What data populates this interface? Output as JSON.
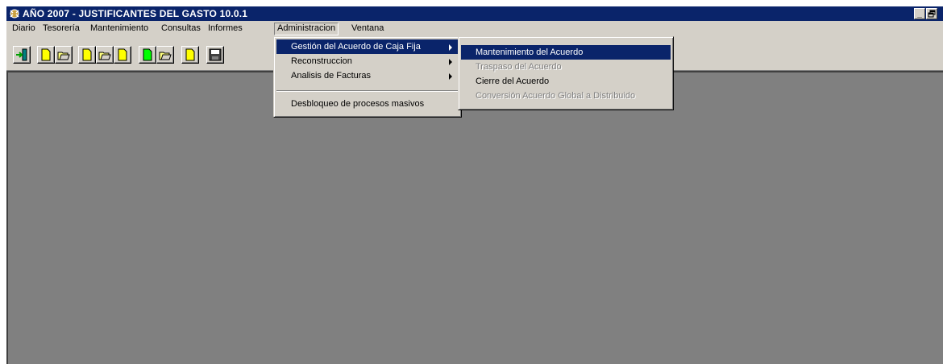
{
  "window": {
    "title": "AÑO 2007 - JUSTIFICANTES DEL GASTO 10.0.1",
    "minimize_label": "_",
    "restore_label": "▫"
  },
  "menubar": {
    "items": [
      {
        "label": "Diario"
      },
      {
        "label": "Tesorería"
      },
      {
        "label": "Mantenimiento"
      },
      {
        "label": "Consultas"
      },
      {
        "label": "Informes"
      },
      {
        "label": "Administracion"
      },
      {
        "label": "Ventana"
      }
    ],
    "active": "Administracion"
  },
  "toolbar": {
    "buttons": [
      {
        "icon": "exit-icon"
      },
      {
        "icon": "new-document-icon"
      },
      {
        "icon": "open-folder-icon"
      },
      {
        "icon": "new-document-icon"
      },
      {
        "icon": "open-folder-icon"
      },
      {
        "icon": "document-icon"
      },
      {
        "icon": "new-document-green-icon"
      },
      {
        "icon": "open-folder-icon"
      },
      {
        "icon": "document-icon"
      },
      {
        "icon": "save-disk-icon"
      }
    ]
  },
  "admin_menu": {
    "items": [
      {
        "label": "Gestión del Acuerdo de Caja Fija",
        "submenu": true,
        "highlighted": true
      },
      {
        "label": "Reconstruccion",
        "submenu": true
      },
      {
        "label": "Analisis de Facturas",
        "submenu": true
      },
      {
        "label": "Desbloqueo de procesos masivos",
        "submenu": false
      }
    ]
  },
  "caja_fija_submenu": {
    "items": [
      {
        "label": "Mantenimiento del Acuerdo",
        "enabled": true,
        "highlighted": true
      },
      {
        "label": "Traspaso del Acuerdo",
        "enabled": false
      },
      {
        "label": "Cierre del Acuerdo",
        "enabled": true
      },
      {
        "label": "Conversión Acuerdo Global a Distribuido",
        "enabled": false
      }
    ]
  },
  "colors": {
    "titlebar": "#0a246a",
    "face": "#d4d0c8",
    "workspace": "#808080",
    "highlight": "#0a246a"
  }
}
